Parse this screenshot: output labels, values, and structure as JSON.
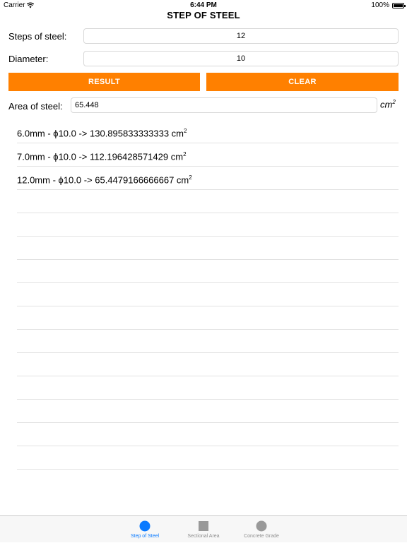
{
  "status_bar": {
    "carrier": "Carrier",
    "time": "6:44 PM",
    "battery": "100%"
  },
  "nav": {
    "title": "STEP OF STEEL"
  },
  "form": {
    "steps_label": "Steps of steel:",
    "steps_value": "12",
    "diameter_label": "Diameter:",
    "diameter_value": "10",
    "result_button": "RESULT",
    "clear_button": "CLEAR",
    "area_label": "Area of steel:",
    "area_value": "65.448",
    "unit_base": "cm",
    "unit_exp": "2"
  },
  "results": [
    {
      "text": "6.0mm - ϕ10.0 -> 130.895833333333 cm",
      "exp": "2"
    },
    {
      "text": "7.0mm - ϕ10.0 -> 112.196428571429 cm",
      "exp": "2"
    },
    {
      "text": "12.0mm - ϕ10.0 -> 65.4479166666667 cm",
      "exp": "2"
    }
  ],
  "tabs": [
    {
      "label": "Step of Steel",
      "icon": "circle-icon",
      "active": true
    },
    {
      "label": "Sectional Area",
      "icon": "square-icon",
      "active": false
    },
    {
      "label": "Concrete Grade",
      "icon": "circle-icon",
      "active": false
    }
  ],
  "colors": {
    "accent": "#ff8000",
    "tab_active": "#0a7aff",
    "tab_inactive": "#8e8e8e"
  }
}
